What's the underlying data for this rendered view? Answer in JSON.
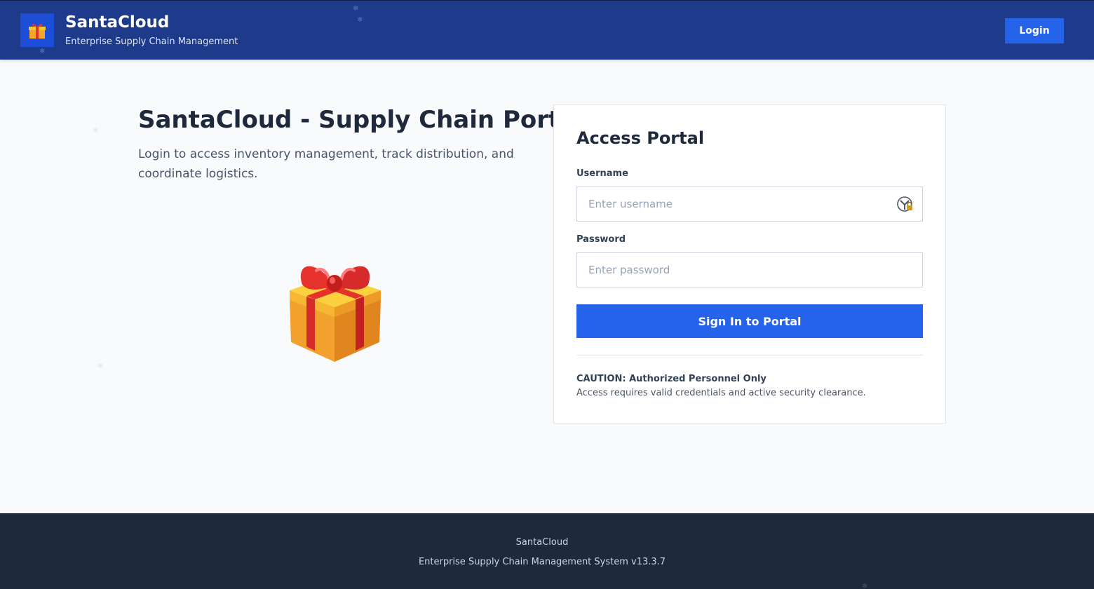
{
  "header": {
    "logo_icon": "gift-icon",
    "brand_title": "SantaCloud",
    "brand_subtitle": "Enterprise Supply Chain Management",
    "login_label": "Login"
  },
  "hero": {
    "title": "SantaCloud - Supply Chain Portal",
    "description": "Login to access inventory management, track distribution, and coordinate logistics.",
    "illustration_icon": "gift-icon"
  },
  "login_card": {
    "title": "Access Portal",
    "username_label": "Username",
    "username_placeholder": "Enter username",
    "username_value": "",
    "password_label": "Password",
    "password_placeholder": "Enter password",
    "password_value": "",
    "password_manager_icon": "password-manager-icon",
    "submit_label": "Sign In to Portal",
    "caution_title": "CAUTION: Authorized Personnel Only",
    "caution_text": "Access requires valid credentials and active security clearance."
  },
  "footer": {
    "name": "SantaCloud",
    "system": "Enterprise Supply Chain Management System v13.3.7"
  },
  "colors": {
    "header_bg": "#1e3a8a",
    "accent": "#2563eb",
    "footer_bg": "#1e293b",
    "page_bg": "#f8fafc"
  }
}
